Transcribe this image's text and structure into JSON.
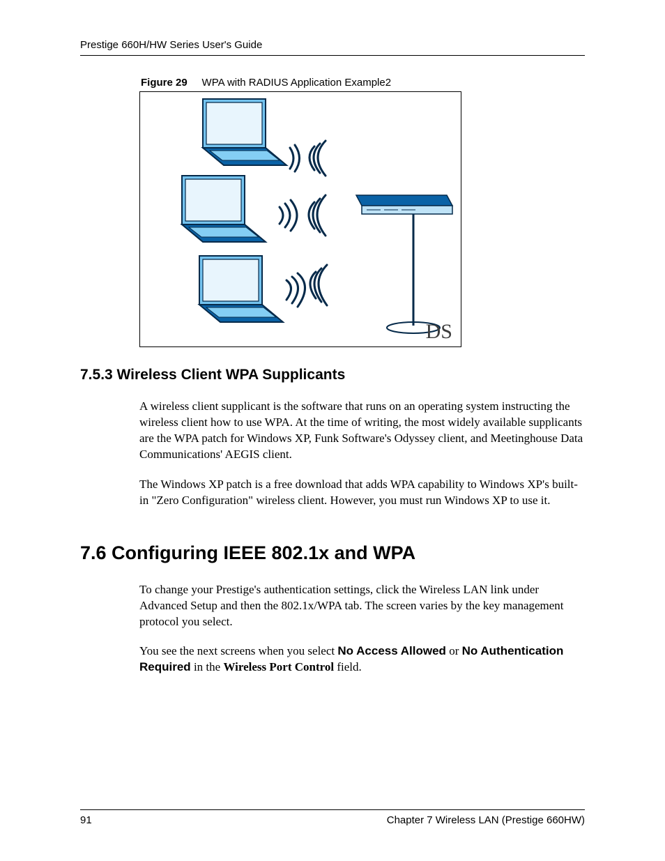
{
  "header": {
    "title": "Prestige 660H/HW Series User's Guide"
  },
  "figure": {
    "label": "Figure 29",
    "caption": "WPA with RADIUS Application Example2",
    "ds_label": "DS"
  },
  "section_753": {
    "heading": "7.5.3  Wireless Client WPA Supplicants",
    "p1": "A wireless client supplicant is the software that runs on an operating system instructing the wireless client how to use WPA. At the time of writing, the most widely available supplicants are the WPA patch for Windows XP, Funk Software's Odyssey client, and Meetinghouse Data Communications' AEGIS client.",
    "p2": "The Windows XP patch is a free download that adds WPA capability to Windows XP's built-in \"Zero Configuration\" wireless client. However, you must run Windows XP to use it."
  },
  "section_76": {
    "heading": "7.6  Configuring IEEE 802.1x and WPA",
    "p1": "To change your Prestige's authentication settings, click the Wireless LAN link under Advanced Setup and then the 802.1x/WPA tab. The screen varies by the key management protocol you select.",
    "p2_pre": "You see the next screens when you select ",
    "p2_b1": "No Access Allowed",
    "p2_mid1": " or ",
    "p2_b2": "No Authentication Required",
    "p2_mid2": " in the ",
    "p2_b3": "Wireless Port Control",
    "p2_post": " field."
  },
  "footer": {
    "page_number": "91",
    "chapter": "Chapter 7 Wireless LAN (Prestige 660HW)"
  }
}
